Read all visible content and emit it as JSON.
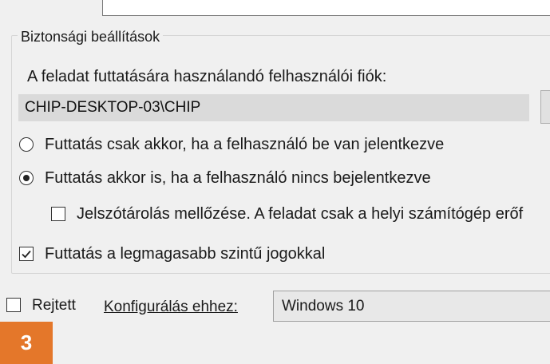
{
  "security_group": {
    "title": "Biztonsági beállítások",
    "account_label": "A feladat futtatására használandó felhasználói fiók:",
    "account_value": "CHIP-DESKTOP-03\\CHIP",
    "radio_logged_on": {
      "label": "Futtatás csak akkor, ha a felhasználó be van jelentkezve",
      "selected": false
    },
    "radio_always": {
      "label": "Futtatás akkor is, ha a felhasználó nincs bejelentkezve",
      "selected": true
    },
    "checkbox_no_password": {
      "label": "Jelszótárolás mellőzése. A feladat csak a helyi számítógép erőf",
      "checked": false
    },
    "checkbox_highest": {
      "label": "Futtatás a legmagasabb szintű jogokkal",
      "checked": true
    }
  },
  "bottom": {
    "hidden_label": "Rejtett",
    "hidden_checked": false,
    "configure_for_label": "Konfigurálás ehhez:",
    "configure_for_value": "Windows 10"
  },
  "badge": {
    "text": "3",
    "color": "#e4772a"
  }
}
